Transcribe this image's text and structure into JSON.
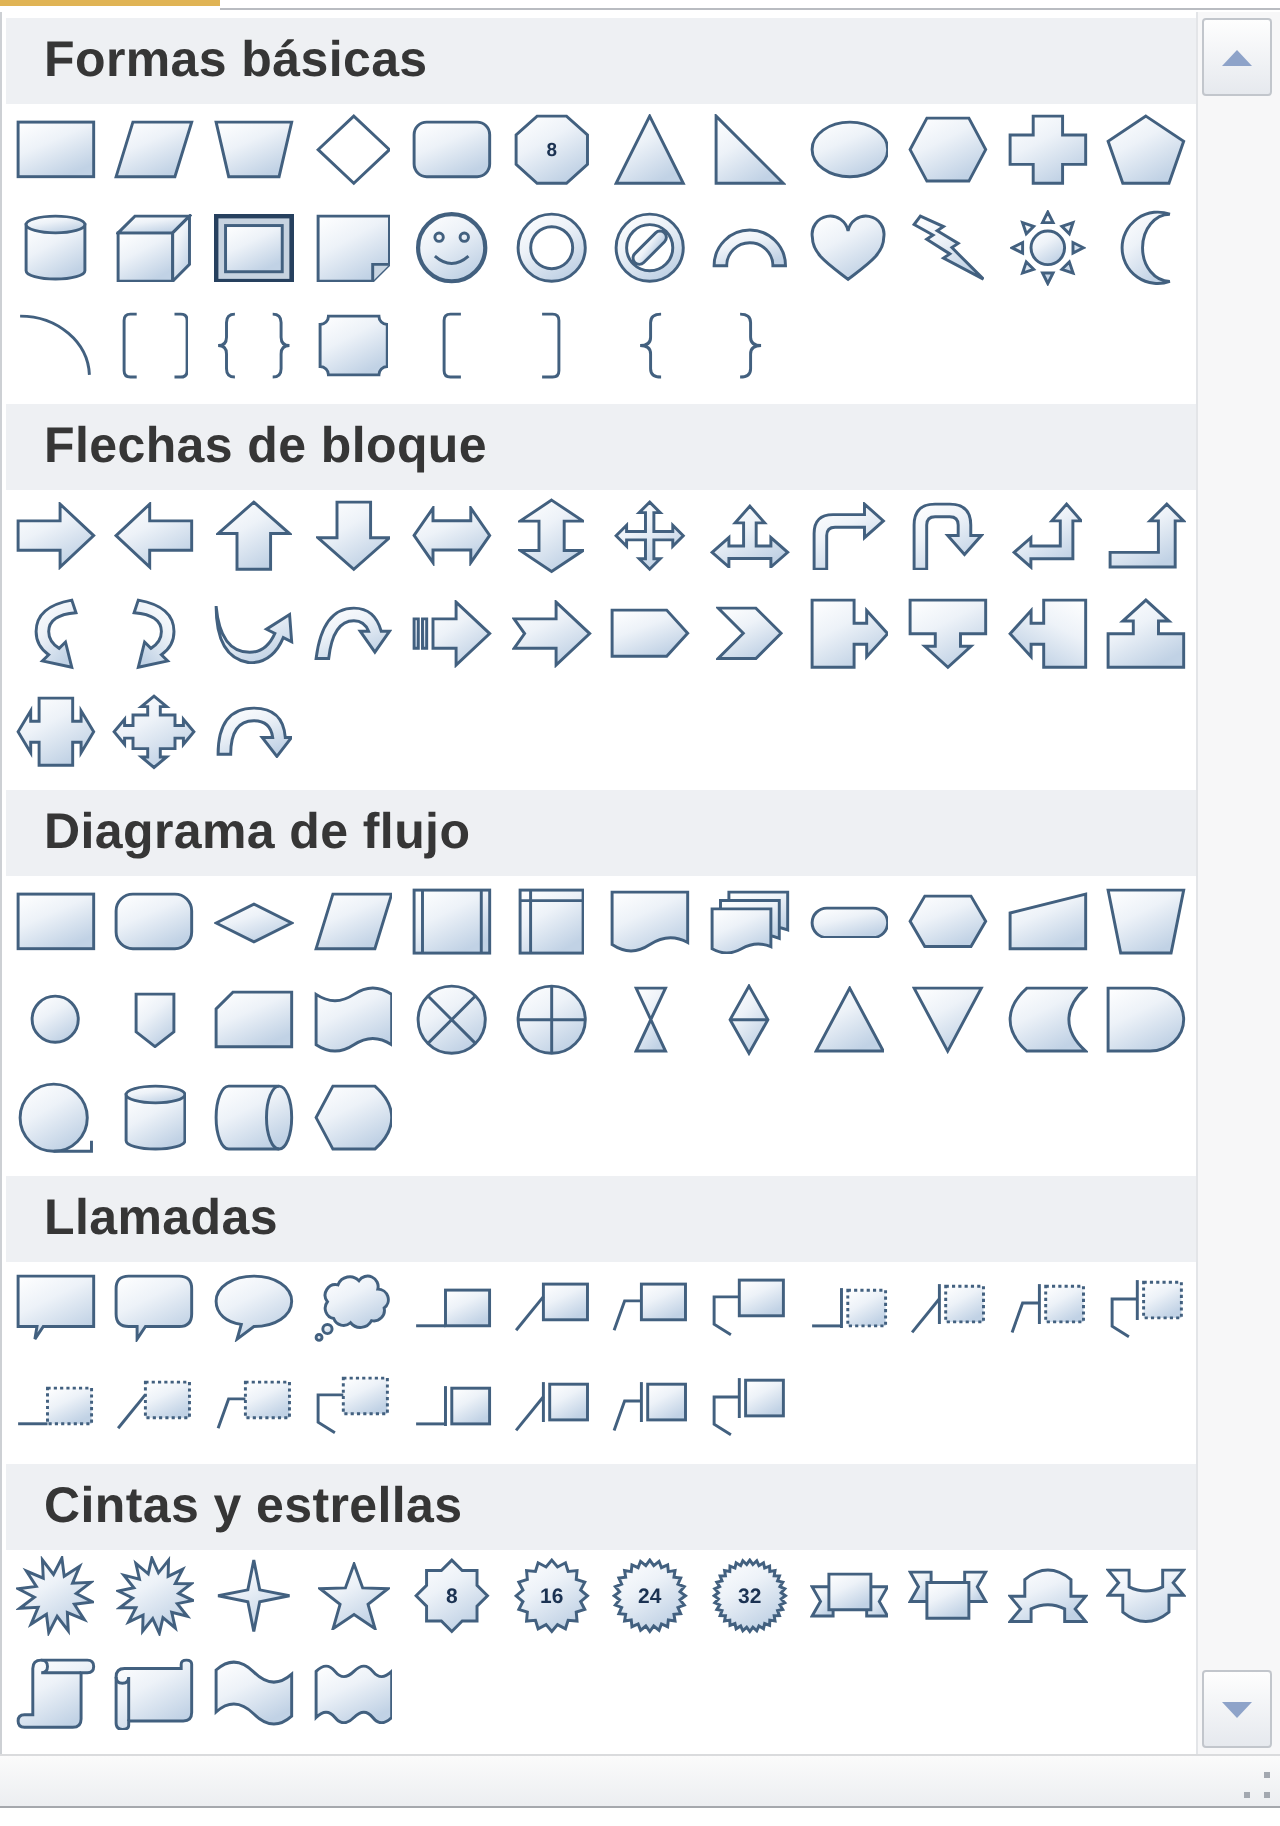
{
  "sections": [
    {
      "title": "Formas básicas",
      "shapes": [
        {
          "kind": "rectangle"
        },
        {
          "kind": "parallelogram"
        },
        {
          "kind": "trapezoid"
        },
        {
          "kind": "diamond"
        },
        {
          "kind": "roundrect"
        },
        {
          "kind": "octagon",
          "label": "8"
        },
        {
          "kind": "triangle"
        },
        {
          "kind": "righttriangle"
        },
        {
          "kind": "oval"
        },
        {
          "kind": "hexagon"
        },
        {
          "kind": "cross"
        },
        {
          "kind": "pentagon"
        },
        {
          "kind": "can"
        },
        {
          "kind": "cube"
        },
        {
          "kind": "bevel"
        },
        {
          "kind": "foldedcorner"
        },
        {
          "kind": "smiley"
        },
        {
          "kind": "donut"
        },
        {
          "kind": "nosymbol"
        },
        {
          "kind": "blockarc"
        },
        {
          "kind": "heart"
        },
        {
          "kind": "lightning"
        },
        {
          "kind": "sun"
        },
        {
          "kind": "moon"
        },
        {
          "kind": "arc"
        },
        {
          "kind": "bracketpair"
        },
        {
          "kind": "bracepair"
        },
        {
          "kind": "plaque"
        },
        {
          "kind": "leftbracket"
        },
        {
          "kind": "rightbracket"
        },
        {
          "kind": "leftbrace"
        },
        {
          "kind": "rightbrace"
        }
      ]
    },
    {
      "title": "Flechas de bloque",
      "shapes": [
        {
          "kind": "rightarrow"
        },
        {
          "kind": "leftarrow"
        },
        {
          "kind": "uparrow"
        },
        {
          "kind": "downarrow"
        },
        {
          "kind": "leftrightarrow"
        },
        {
          "kind": "updownarrow"
        },
        {
          "kind": "quadarrow"
        },
        {
          "kind": "leftrightuparrow"
        },
        {
          "kind": "bentarrow"
        },
        {
          "kind": "uturnarrow"
        },
        {
          "kind": "leftuparrow"
        },
        {
          "kind": "bentuparrow"
        },
        {
          "kind": "curvedrightarrow"
        },
        {
          "kind": "curvedleftarrow"
        },
        {
          "kind": "curveduparrow"
        },
        {
          "kind": "curveddownarrow"
        },
        {
          "kind": "stripedrightarrow"
        },
        {
          "kind": "notchedrightarrow"
        },
        {
          "kind": "homeplate"
        },
        {
          "kind": "chevron"
        },
        {
          "kind": "rightarrowcallout"
        },
        {
          "kind": "downarrowcallout"
        },
        {
          "kind": "leftarrowcallout"
        },
        {
          "kind": "uparrowcallout"
        },
        {
          "kind": "leftrightarrowcallout"
        },
        {
          "kind": "quadarrowcallout"
        },
        {
          "kind": "circulararrow"
        }
      ]
    },
    {
      "title": "Diagrama de flujo",
      "shapes": [
        {
          "kind": "process"
        },
        {
          "kind": "alternateprocess"
        },
        {
          "kind": "decision"
        },
        {
          "kind": "data"
        },
        {
          "kind": "predefinedprocess"
        },
        {
          "kind": "internalstorage"
        },
        {
          "kind": "document"
        },
        {
          "kind": "multidocument"
        },
        {
          "kind": "terminator"
        },
        {
          "kind": "preparation"
        },
        {
          "kind": "manualinput"
        },
        {
          "kind": "manualoperation"
        },
        {
          "kind": "connector"
        },
        {
          "kind": "offpageconnector"
        },
        {
          "kind": "card"
        },
        {
          "kind": "punchedtape"
        },
        {
          "kind": "summingjunction"
        },
        {
          "kind": "or"
        },
        {
          "kind": "collate"
        },
        {
          "kind": "sort"
        },
        {
          "kind": "extract"
        },
        {
          "kind": "merge"
        },
        {
          "kind": "storeddata"
        },
        {
          "kind": "delay"
        },
        {
          "kind": "sequentialaccess"
        },
        {
          "kind": "magneticdisk"
        },
        {
          "kind": "directaccess"
        },
        {
          "kind": "display"
        }
      ]
    },
    {
      "title": "Llamadas",
      "shapes": [
        {
          "kind": "rectcallout"
        },
        {
          "kind": "roundrectcallout"
        },
        {
          "kind": "ovalcallout"
        },
        {
          "kind": "cloudcallout"
        },
        {
          "kind": "callout1"
        },
        {
          "kind": "callout2"
        },
        {
          "kind": "callout3"
        },
        {
          "kind": "callout4"
        },
        {
          "kind": "accentcallout1"
        },
        {
          "kind": "accentcallout2"
        },
        {
          "kind": "accentcallout3"
        },
        {
          "kind": "accentcallout4"
        },
        {
          "kind": "plaincallout1"
        },
        {
          "kind": "plaincallout2"
        },
        {
          "kind": "plaincallout3"
        },
        {
          "kind": "plaincallout4"
        },
        {
          "kind": "accentbordercallout1"
        },
        {
          "kind": "accentbordercallout2"
        },
        {
          "kind": "accentbordercallout3"
        },
        {
          "kind": "accentbordercallout4"
        }
      ]
    },
    {
      "title": "Cintas y estrellas",
      "shapes": [
        {
          "kind": "explosion1"
        },
        {
          "kind": "explosion2"
        },
        {
          "kind": "star4"
        },
        {
          "kind": "star5"
        },
        {
          "kind": "star8",
          "label": "8"
        },
        {
          "kind": "star16",
          "label": "16"
        },
        {
          "kind": "star24",
          "label": "24"
        },
        {
          "kind": "star32",
          "label": "32"
        },
        {
          "kind": "ribbondown"
        },
        {
          "kind": "ribbonup"
        },
        {
          "kind": "curvedribbondown"
        },
        {
          "kind": "curvedribbonup"
        },
        {
          "kind": "verticalscroll"
        },
        {
          "kind": "horizontalscroll"
        },
        {
          "kind": "wave"
        },
        {
          "kind": "doublewave"
        }
      ]
    }
  ]
}
